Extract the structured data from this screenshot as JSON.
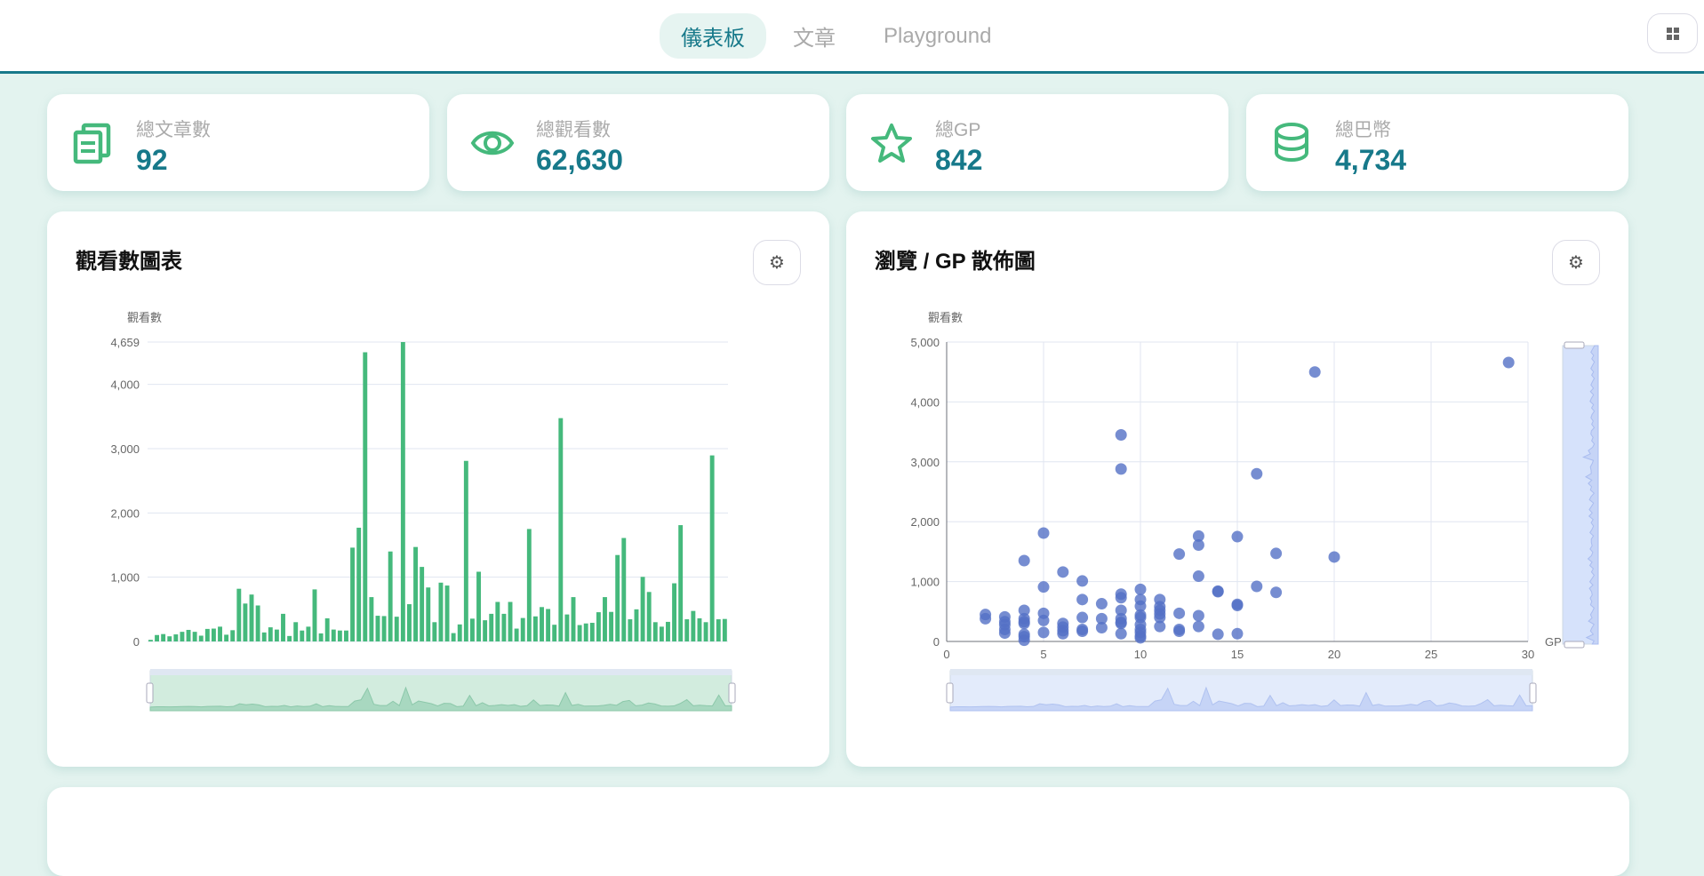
{
  "nav": {
    "items": [
      {
        "label": "儀表板",
        "active": true
      },
      {
        "label": "文章",
        "active": false
      },
      {
        "label": "Playground",
        "active": false
      }
    ],
    "menu_icon": "grid-icon"
  },
  "stats": [
    {
      "label": "總文章數",
      "value": "92",
      "icon": "documents-icon"
    },
    {
      "label": "總觀看數",
      "value": "62,630",
      "icon": "eye-icon"
    },
    {
      "label": "總GP",
      "value": "842",
      "icon": "star-icon"
    },
    {
      "label": "總巴幣",
      "value": "4,734",
      "icon": "coins-icon"
    }
  ],
  "colors": {
    "accent": "#17798a",
    "green": "#45b97c",
    "scatter": "#5470c6",
    "background": "#e3f3ef"
  },
  "panels": {
    "views": {
      "title": "觀看數圖表"
    },
    "scatter": {
      "title": "瀏覽 / GP 散佈圖"
    }
  },
  "chart_data": [
    {
      "type": "bar",
      "title": "",
      "ylabel": "觀看數",
      "xlabel": "",
      "ylim": [
        0,
        4659
      ],
      "yticks": [
        "0",
        "1,000",
        "2,000",
        "3,000",
        "4,000",
        "4,659"
      ],
      "grid": true,
      "datazoom": "bottom slider",
      "values": [
        25,
        100,
        115,
        80,
        110,
        150,
        180,
        150,
        90,
        195,
        200,
        230,
        105,
        175,
        820,
        590,
        730,
        560,
        140,
        220,
        185,
        430,
        85,
        300,
        170,
        230,
        810,
        125,
        360,
        185,
        170,
        170,
        1460,
        1770,
        4500,
        690,
        400,
        395,
        1400,
        385,
        4659,
        580,
        1470,
        1160,
        840,
        300,
        915,
        870,
        130,
        265,
        2810,
        355,
        1085,
        330,
        430,
        615,
        430,
        615,
        200,
        365,
        1750,
        390,
        535,
        505,
        260,
        3475,
        420,
        690,
        255,
        280,
        290,
        455,
        690,
        460,
        1345,
        1610,
        345,
        500,
        1005,
        770,
        300,
        230,
        305,
        905,
        1810,
        345,
        475,
        360,
        300,
        2895,
        345,
        350
      ]
    },
    {
      "type": "scatter",
      "title": "",
      "xlabel": "GP",
      "ylabel": "觀看數",
      "xlim": [
        0,
        30
      ],
      "ylim": [
        0,
        5000
      ],
      "xticks": [
        "0",
        "5",
        "10",
        "15",
        "20",
        "25",
        "30"
      ],
      "yticks": [
        "0",
        "1,000",
        "2,000",
        "3,000",
        "4,000",
        "5,000"
      ],
      "grid": true,
      "datazoom": "bottom and right sliders",
      "points": [
        [
          2,
          450
        ],
        [
          2,
          380
        ],
        [
          3,
          410
        ],
        [
          3,
          330
        ],
        [
          3,
          280
        ],
        [
          3,
          200
        ],
        [
          3,
          140
        ],
        [
          4,
          1350
        ],
        [
          4,
          520
        ],
        [
          4,
          380
        ],
        [
          4,
          330
        ],
        [
          4,
          300
        ],
        [
          4,
          120
        ],
        [
          4,
          80
        ],
        [
          4,
          20
        ],
        [
          5,
          1810
        ],
        [
          5,
          910
        ],
        [
          5,
          470
        ],
        [
          5,
          350
        ],
        [
          5,
          150
        ],
        [
          6,
          1160
        ],
        [
          6,
          300
        ],
        [
          6,
          240
        ],
        [
          6,
          180
        ],
        [
          6,
          130
        ],
        [
          7,
          1010
        ],
        [
          7,
          700
        ],
        [
          7,
          400
        ],
        [
          7,
          200
        ],
        [
          7,
          170
        ],
        [
          8,
          630
        ],
        [
          8,
          380
        ],
        [
          8,
          230
        ],
        [
          9,
          3450
        ],
        [
          9,
          2880
        ],
        [
          9,
          790
        ],
        [
          9,
          730
        ],
        [
          9,
          520
        ],
        [
          9,
          380
        ],
        [
          9,
          320
        ],
        [
          9,
          300
        ],
        [
          9,
          130
        ],
        [
          10,
          870
        ],
        [
          10,
          700
        ],
        [
          10,
          590
        ],
        [
          10,
          440
        ],
        [
          10,
          400
        ],
        [
          10,
          280
        ],
        [
          10,
          200
        ],
        [
          10,
          150
        ],
        [
          10,
          90
        ],
        [
          10,
          60
        ],
        [
          11,
          700
        ],
        [
          11,
          580
        ],
        [
          11,
          520
        ],
        [
          11,
          460
        ],
        [
          11,
          400
        ],
        [
          11,
          250
        ],
        [
          12,
          1460
        ],
        [
          12,
          470
        ],
        [
          12,
          200
        ],
        [
          12,
          170
        ],
        [
          13,
          1760
        ],
        [
          13,
          1610
        ],
        [
          13,
          1090
        ],
        [
          13,
          430
        ],
        [
          13,
          250
        ],
        [
          14,
          840
        ],
        [
          14,
          830
        ],
        [
          14,
          120
        ],
        [
          15,
          1750
        ],
        [
          15,
          620
        ],
        [
          15,
          600
        ],
        [
          15,
          130
        ],
        [
          16,
          2800
        ],
        [
          16,
          920
        ],
        [
          17,
          1470
        ],
        [
          17,
          820
        ],
        [
          19,
          4500
        ],
        [
          20,
          1410
        ],
        [
          29,
          4659
        ]
      ]
    }
  ]
}
